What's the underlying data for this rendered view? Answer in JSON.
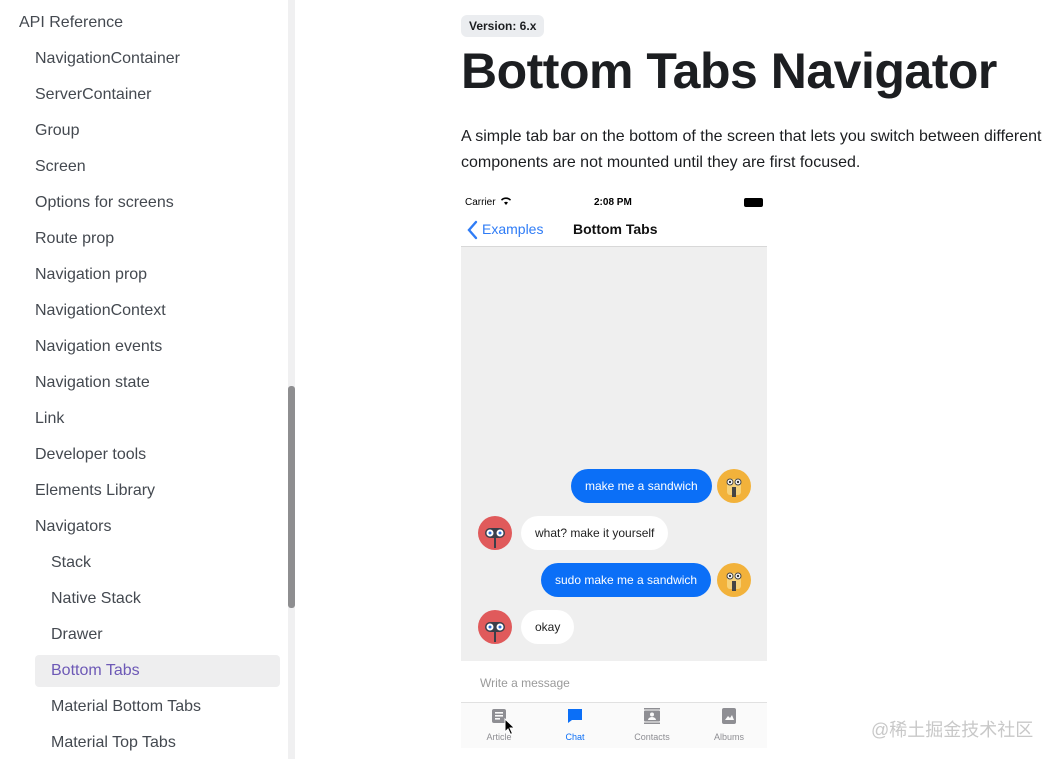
{
  "sidebar": {
    "section_label": "API Reference",
    "items": [
      "NavigationContainer",
      "ServerContainer",
      "Group",
      "Screen",
      "Options for screens",
      "Route prop",
      "Navigation prop",
      "NavigationContext",
      "Navigation events",
      "Navigation state",
      "Link",
      "Developer tools",
      "Elements Library",
      "Navigators"
    ],
    "sub_items": [
      "Stack",
      "Native Stack",
      "Drawer",
      "Bottom Tabs",
      "Material Bottom Tabs",
      "Material Top Tabs"
    ],
    "active_item": "Bottom Tabs",
    "active_color": "#6d59b6"
  },
  "main": {
    "version_badge": "Version: 6.x",
    "title": "Bottom Tabs Navigator",
    "intro_line1": "A simple tab bar on the bottom of the screen that lets you switch between different",
    "intro_line2": "components are not mounted until they are first focused."
  },
  "phone": {
    "carrier": "Carrier",
    "time": "2:08 PM",
    "back_label": "Examples",
    "nav_title": "Bottom Tabs",
    "messages": [
      {
        "from": "me",
        "text": "make me a sandwich"
      },
      {
        "from": "bot",
        "text": "what? make it yourself"
      },
      {
        "from": "me",
        "text": "sudo make me a sandwich"
      },
      {
        "from": "bot",
        "text": "okay"
      }
    ],
    "composer_placeholder": "Write a message",
    "tabs": [
      {
        "label": "Article",
        "icon": "article-icon"
      },
      {
        "label": "Chat",
        "icon": "chat-icon"
      },
      {
        "label": "Contacts",
        "icon": "contacts-icon"
      },
      {
        "label": "Albums",
        "icon": "albums-icon"
      }
    ],
    "active_tab": "Chat",
    "accent_color": "#0b6ff7"
  },
  "watermark": "@稀土掘金技术社区"
}
